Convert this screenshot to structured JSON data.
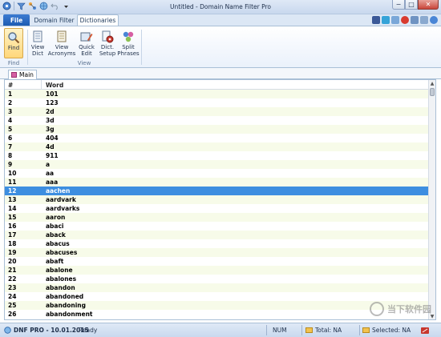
{
  "window": {
    "title": "Untitled - Domain Name Filter Pro",
    "minimize": "−",
    "maximize": "□",
    "close": "✕"
  },
  "tabs": {
    "file": "File",
    "domain_filter": "Domain Filter",
    "dictionaries": "Dictionaries"
  },
  "ribbon": {
    "find": {
      "label": "Find",
      "group": "Find"
    },
    "view_group": "View",
    "buttons": [
      {
        "label": "View\nDict"
      },
      {
        "label": "View\nAcronyms"
      },
      {
        "label": "Quick\nEdit"
      },
      {
        "label": "Dict.\nSetup"
      },
      {
        "label": "Split\nPhrases"
      }
    ]
  },
  "document_tab": "Main",
  "grid": {
    "col_num": "#",
    "col_word": "Word",
    "selected_index": 11,
    "rows": [
      {
        "num": "1",
        "word": "101"
      },
      {
        "num": "2",
        "word": "123"
      },
      {
        "num": "3",
        "word": "2d"
      },
      {
        "num": "4",
        "word": "3d"
      },
      {
        "num": "5",
        "word": "3g"
      },
      {
        "num": "6",
        "word": "404"
      },
      {
        "num": "7",
        "word": "4d"
      },
      {
        "num": "8",
        "word": "911"
      },
      {
        "num": "9",
        "word": "a"
      },
      {
        "num": "10",
        "word": "aa"
      },
      {
        "num": "11",
        "word": "aaa"
      },
      {
        "num": "12",
        "word": "aachen"
      },
      {
        "num": "13",
        "word": "aardvark"
      },
      {
        "num": "14",
        "word": "aardvarks"
      },
      {
        "num": "15",
        "word": "aaron"
      },
      {
        "num": "16",
        "word": "abaci"
      },
      {
        "num": "17",
        "word": "aback"
      },
      {
        "num": "18",
        "word": "abacus"
      },
      {
        "num": "19",
        "word": "abacuses"
      },
      {
        "num": "20",
        "word": "abaft"
      },
      {
        "num": "21",
        "word": "abalone"
      },
      {
        "num": "22",
        "word": "abalones"
      },
      {
        "num": "23",
        "word": "abandon"
      },
      {
        "num": "24",
        "word": "abandoned"
      },
      {
        "num": "25",
        "word": "abandoning"
      },
      {
        "num": "26",
        "word": "abandonment"
      }
    ]
  },
  "statusbar": {
    "app": "DNF PRO - 10.01.2015",
    "state": "Ready",
    "num": "NUM",
    "total": "Total: NA",
    "selected": "Selected: NA"
  },
  "watermark": "当下软件园",
  "colors": {
    "selection": "#3d8ee0",
    "alt_row": "#f7fbe9",
    "file_tab": "#1e5cb3"
  }
}
